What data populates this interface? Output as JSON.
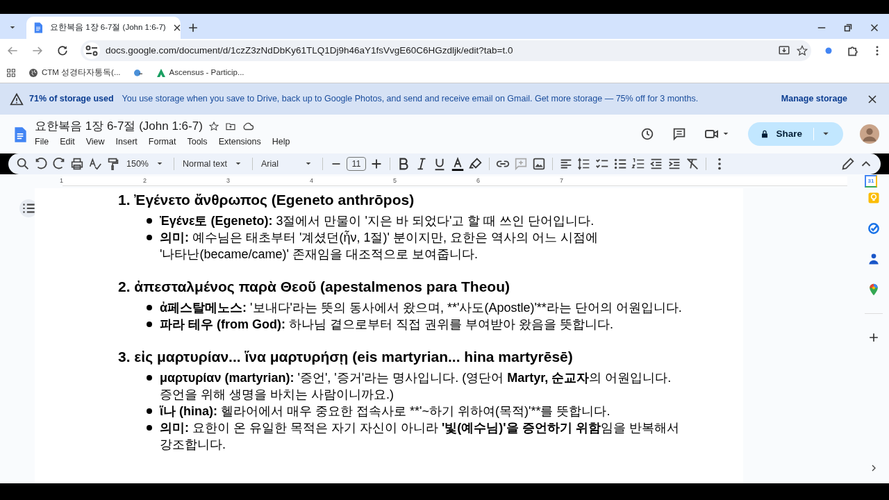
{
  "browser": {
    "tab_title": "요한복음 1장 6-7절 (John 1:6-7)",
    "url": "docs.google.com/document/d/1czZ3zNdDbKy61TLQ1Dj9h46aY1fsVvgE60C6HGzdljk/edit?tab=t.0",
    "bookmarks": [
      "CTM 성경타자통독(...",
      "Ascensus - Particip..."
    ]
  },
  "banner": {
    "title": "71% of storage used",
    "message": "You use storage when you save to Drive, back up to Google Photos, and send and receive email on Gmail. Get more storage — 75% off for 3 months.",
    "action": "Manage storage"
  },
  "doc": {
    "title": "요한복음 1장 6-7절 (John 1:6-7)",
    "menu": [
      "File",
      "Edit",
      "View",
      "Insert",
      "Format",
      "Tools",
      "Extensions",
      "Help"
    ],
    "share": "Share"
  },
  "toolbar": {
    "zoom": "150%",
    "style": "Normal text",
    "font": "Arial",
    "font_size": "11"
  },
  "ruler": [
    "1",
    "2",
    "3",
    "4",
    "5",
    "6",
    "7"
  ],
  "side_panel": {
    "calendar_day": "31"
  },
  "sections": [
    {
      "heading": "1. Ἐγένετο ἄνθρωπος (Egeneto anthrōpos)",
      "bullets": [
        {
          "lines": [
            [
              {
                "text": "Ἐγένε토 (Egeneto):",
                "bold": true
              },
              {
                "text": " 3절에서 만물이 '지은 바 되었다'고 할 때 쓰인 단어입니다.",
                "bold": false
              }
            ]
          ]
        },
        {
          "lines": [
            [
              {
                "text": "의미:",
                "bold": true
              },
              {
                "text": " 예수님은 태초부터 '계셨던(ἦν, 1절)' 분이지만, 요한은 역사의 어느 시점에",
                "bold": false
              }
            ],
            [
              {
                "text": "'나타난(became/came)' 존재임을 대조적으로 보여줍니다.",
                "bold": false
              }
            ]
          ]
        }
      ]
    },
    {
      "heading": "2. ἀπεσταλμένος παρὰ Θεοῦ (apestalmenos para Theou)",
      "bullets": [
        {
          "lines": [
            [
              {
                "text": "ἀ페스탈메노스:",
                "bold": true
              },
              {
                "text": " '보내다'라는 뜻의 동사에서 왔으며, **'사도(Apostle)'**라는 단어의 어원입니다.",
                "bold": false
              }
            ]
          ]
        },
        {
          "lines": [
            [
              {
                "text": "파라 테우 (from God):",
                "bold": true
              },
              {
                "text": " 하나님 곁으로부터 직접 권위를 부여받아 왔음을 뜻합니다.",
                "bold": false
              }
            ]
          ]
        }
      ]
    },
    {
      "heading": "3. εἰς μαρτυρίαν... ἵνα μαρτυρήσῃ (eis martyrian... hina martyrēsē)",
      "bullets": [
        {
          "lines": [
            [
              {
                "text": "μαρτυρίαν (martyrian):",
                "bold": true
              },
              {
                "text": " '증언', '증거'라는 명사입니다. (영단어 ",
                "bold": false
              },
              {
                "text": "Martyr, 순교자",
                "bold": true
              },
              {
                "text": "의 어원입니다.",
                "bold": false
              }
            ],
            [
              {
                "text": "증언을 위해 생명을 바치는 사람이니까요.)",
                "bold": false
              }
            ]
          ]
        },
        {
          "lines": [
            [
              {
                "text": "ἵ나 (hina):",
                "bold": true
              },
              {
                "text": " 헬라어에서 매우 중요한 접속사로 **'~하기 위하여(목적)'**를 뜻합니다.",
                "bold": false
              }
            ]
          ]
        },
        {
          "lines": [
            [
              {
                "text": "의미:",
                "bold": true
              },
              {
                "text": " 요한이 온 유일한 목적은 자기 자신이 아니라 ",
                "bold": false
              },
              {
                "text": "'빛(예수님)'을 증언하기 위함",
                "bold": true
              },
              {
                "text": "임을 반복해서",
                "bold": false
              }
            ],
            [
              {
                "text": "강조합니다.",
                "bold": false
              }
            ]
          ]
        }
      ]
    }
  ]
}
